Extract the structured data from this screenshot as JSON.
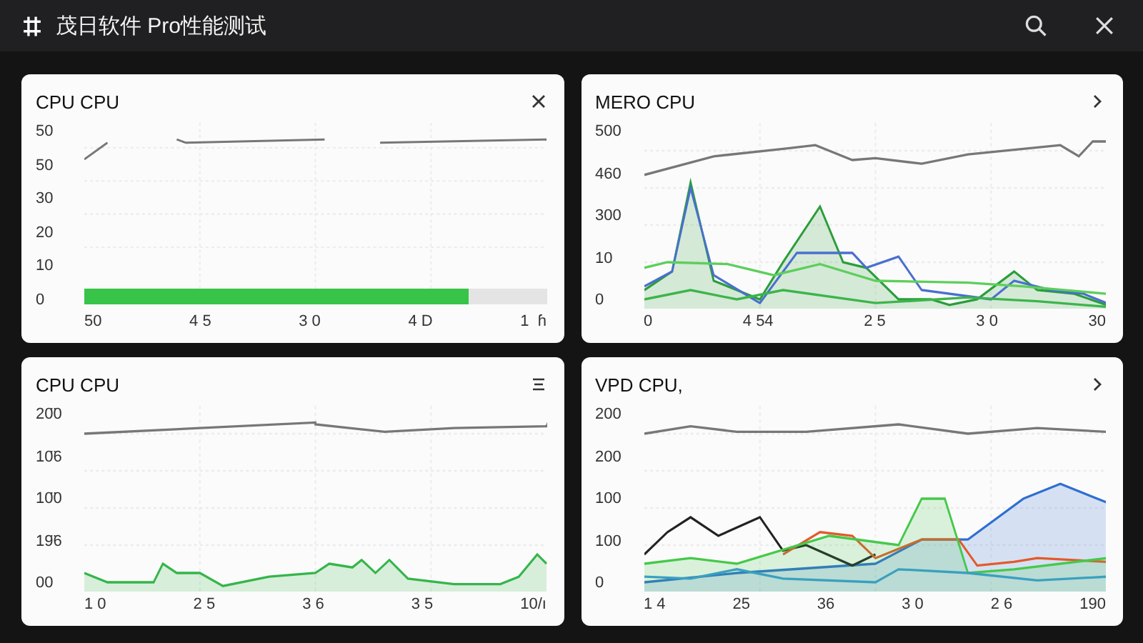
{
  "window": {
    "title": "茂日软件 Pro性能测试"
  },
  "panels": [
    {
      "title": "CPU CPU",
      "kind": "close",
      "y_labels": [
        "50",
        "50",
        "30",
        "20",
        "10",
        "0"
      ],
      "x_labels": [
        "50",
        "4 5",
        "3 0",
        "4 D",
        "1  ɦ"
      ],
      "bar": {
        "level": 0.83
      }
    },
    {
      "title": "MERO CPU",
      "kind": "chevron",
      "y_labels": [
        "500",
        "460",
        "300",
        "10",
        "0"
      ],
      "x_labels": [
        "0",
        "4 54",
        "2 5",
        "3 0",
        "30"
      ]
    },
    {
      "title": "CPU CPU",
      "kind": "menu",
      "y_labels": [
        "20̈0",
        "10̈6",
        "10̈0",
        "19̈6",
        "00"
      ],
      "x_labels": [
        "1 0",
        "2 5",
        "3 6",
        "3 5",
        "10/ı"
      ]
    },
    {
      "title": "VPD CPU,",
      "kind": "chevron",
      "y_labels": [
        "200",
        "200",
        "100",
        "100",
        "0"
      ],
      "x_labels": [
        "1 4",
        "25",
        "36",
        "3 0",
        "2 6",
        "190"
      ]
    }
  ]
}
